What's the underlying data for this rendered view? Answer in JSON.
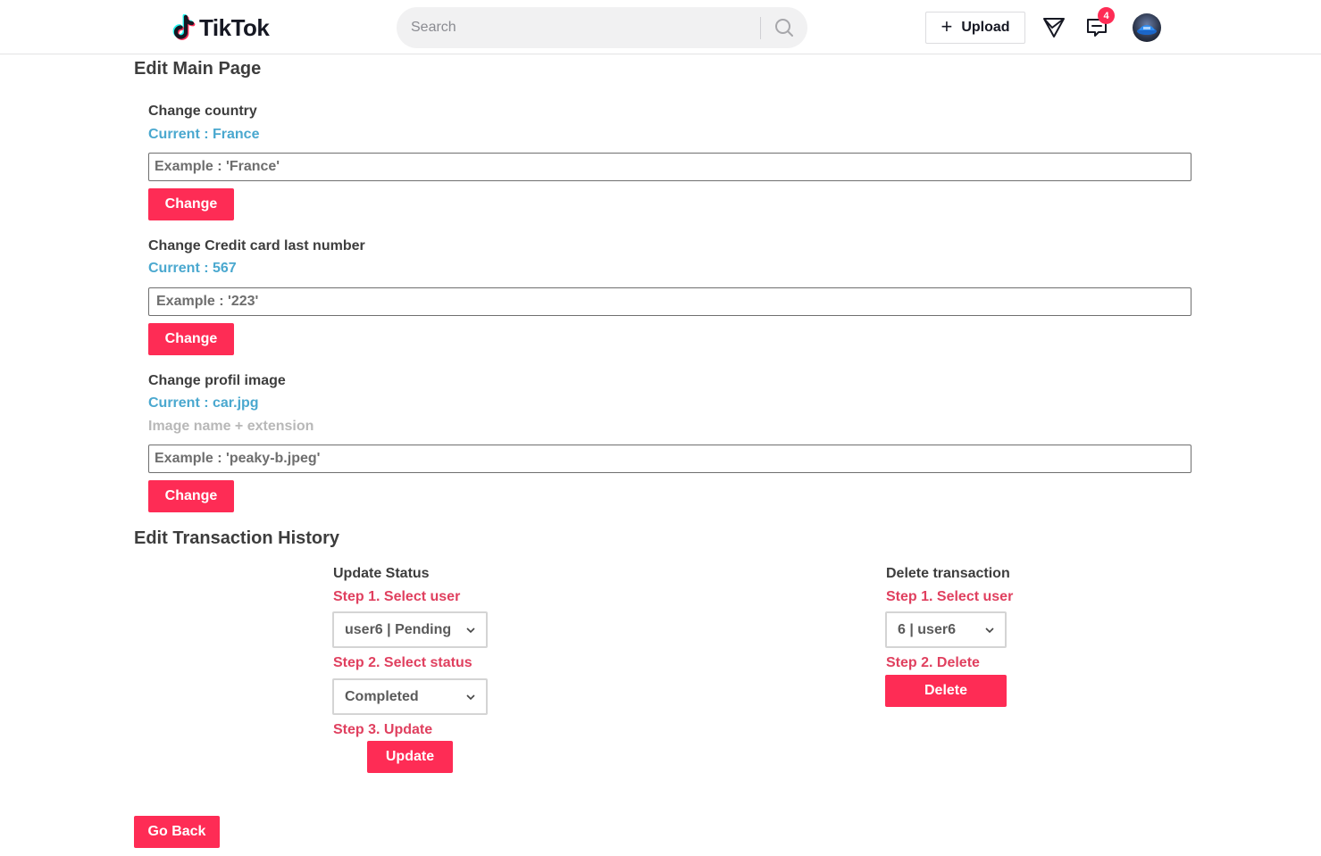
{
  "header": {
    "logo_text": "TikTok",
    "search_placeholder": "Search",
    "upload_label": "Upload",
    "notification_count": "4"
  },
  "edit_main": {
    "title": "Edit Main Page",
    "country": {
      "label": "Change country",
      "current": "Current : France",
      "placeholder": "Example : 'France'",
      "button": "Change"
    },
    "credit_card": {
      "label": "Change Credit card last number",
      "current": "Current : 567",
      "placeholder": "Example : '223'",
      "button": "Change"
    },
    "profile_image": {
      "label": "Change profil image",
      "current": "Current : car.jpg",
      "hint": "Image name + extension",
      "placeholder": "Example : 'peaky-b.jpeg'",
      "button": "Change"
    }
  },
  "transactions": {
    "title": "Edit Transaction History",
    "update": {
      "title": "Update Status",
      "step1": "Step 1. Select user",
      "user_select": "user6 | Pending",
      "step2": "Step 2. Select status",
      "status_select": "Completed",
      "step3": "Step 3. Update",
      "button": "Update"
    },
    "delete": {
      "title": "Delete transaction",
      "step1": "Step 1. Select user",
      "user_select": "6 | user6",
      "step2": "Step 2. Delete",
      "button": "Delete"
    }
  },
  "go_back_label": "Go Back",
  "colors": {
    "brand": "#fe2c55",
    "current_text": "#4aa8cf",
    "step_text": "#e0405f",
    "tiktok_cyan": "#25f4ee"
  }
}
